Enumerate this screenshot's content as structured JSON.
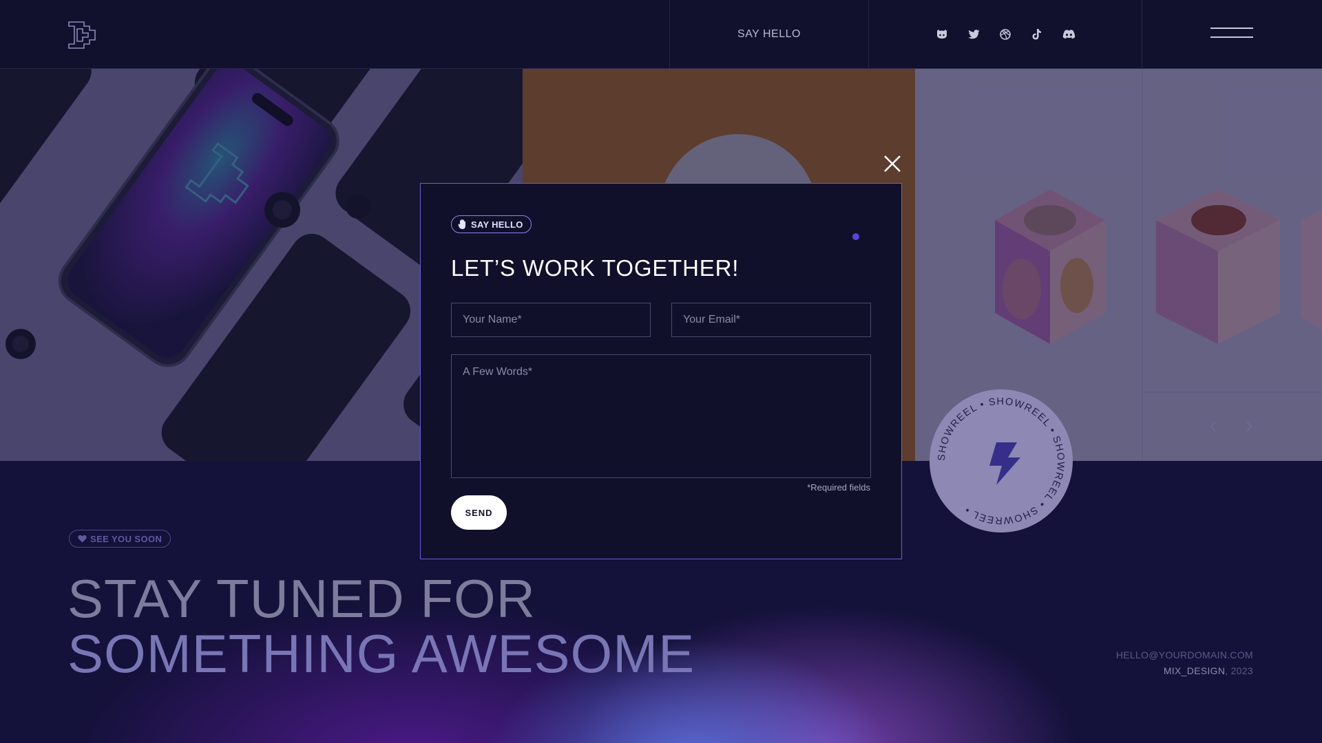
{
  "header": {
    "say_hello": "SAY HELLO",
    "social_icons": [
      "github-icon",
      "twitter-icon",
      "dribbble-icon",
      "tiktok-icon",
      "discord-icon"
    ]
  },
  "modal": {
    "badge": "SAY HELLO",
    "title": "LET’S WORK TOGETHER!",
    "name_placeholder": "Your Name*",
    "email_placeholder": "Your Email*",
    "message_placeholder": "A Few Words*",
    "required_note": "*Required fields",
    "send_label": "SEND"
  },
  "footer": {
    "badge": "SEE YOU SOON",
    "headline_line1": "STAY TUNED FOR",
    "headline_line2": "SOMETHING AWESOME",
    "email": "HELLO@YOURDOMAIN.COM",
    "brand": "MIX_DESIGN",
    "year": ", 2023"
  },
  "showreel": {
    "ring_text": "SHOWREEL • SHOWREEL • SHOWREEL • SHOWREEL • "
  },
  "colors": {
    "background": "#10102b",
    "accent": "#6b5fd6",
    "button": "#ffffff"
  }
}
